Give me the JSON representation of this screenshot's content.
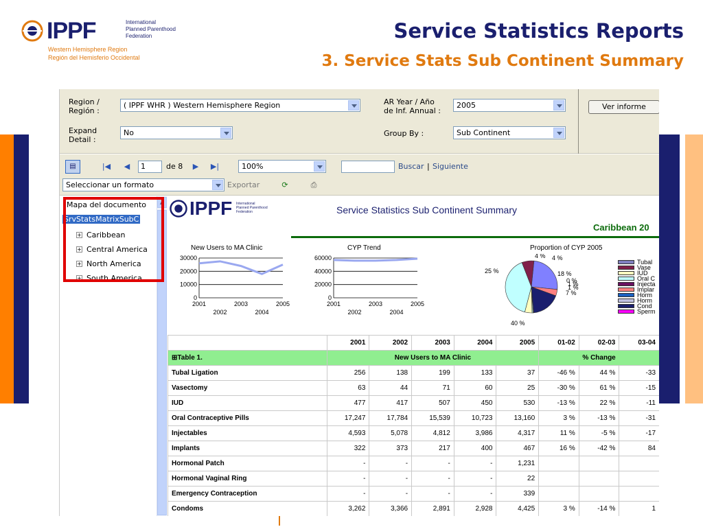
{
  "slide": {
    "logo_brand": "IPPF",
    "logo_federation": [
      "International",
      "Planned Parenthood",
      "Federation"
    ],
    "logo_region": [
      "Western Hemisphere Region",
      "Región del Hemisferio Occidental"
    ],
    "title": "Service Statistics Reports",
    "subtitle": "3. Service Stats Sub Continent Summary",
    "colors": {
      "navy": "#1a1f6e",
      "orange": "#ff7f00",
      "peach": "#ffc080",
      "accent_text": "#e07a10"
    }
  },
  "params": {
    "region_label": "Region /\nRegión :",
    "region_value": "( IPPF WHR ) Western Hemisphere Region",
    "year_label": "AR Year / Año\nde Inf. Annual :",
    "year_value": "2005",
    "expand_label": "Expand\nDetail :",
    "expand_value": "No",
    "groupby_label": "Group By :",
    "groupby_value": "Sub Continent",
    "view_button": "Ver informe"
  },
  "toolbar": {
    "page_current": "1",
    "page_of": "de 8",
    "zoom": "100%",
    "search_find": "Buscar",
    "search_sep": "|",
    "search_next": "Siguiente",
    "format_select": "Seleccionar un formato",
    "export_label": "Exportar",
    "icons": [
      "doc-map-toggle-icon",
      "first-page-icon",
      "prev-page-icon",
      "next-page-icon",
      "last-page-icon",
      "refresh-icon",
      "print-icon"
    ]
  },
  "docmap": {
    "title": "Mapa del documento",
    "root": "SrvStatsMatrixSubC",
    "items": [
      "Caribbean",
      "Central America",
      "North America",
      "South America"
    ]
  },
  "report": {
    "header_logo": "IPPF",
    "header_logo_small": [
      "International",
      "Planned Parenthood",
      "Federation"
    ],
    "title": "Service Statistics Sub Continent Summary",
    "subcontinent": "Caribbean 20",
    "chart_titles": [
      "New Users to MA Clinic",
      "CYP Trend",
      "Proportion of CYP 2005"
    ],
    "table": {
      "columns": [
        "2001",
        "2002",
        "2003",
        "2004",
        "2005",
        "01-02",
        "02-03",
        "03-04"
      ],
      "group_label": "Table 1.",
      "group_values": "New Users to MA Clinic",
      "group_change": "% Change",
      "rows": [
        {
          "name": "Tubal Ligation",
          "v": [
            "256",
            "138",
            "199",
            "133",
            "37"
          ],
          "p": [
            "-46 %",
            "44 %",
            "-33"
          ]
        },
        {
          "name": "Vasectomy",
          "v": [
            "63",
            "44",
            "71",
            "60",
            "25"
          ],
          "p": [
            "-30 %",
            "61 %",
            "-15"
          ]
        },
        {
          "name": "IUD",
          "v": [
            "477",
            "417",
            "507",
            "450",
            "530"
          ],
          "p": [
            "-13 %",
            "22 %",
            "-11"
          ]
        },
        {
          "name": "Oral Contraceptive Pills",
          "v": [
            "17,247",
            "17,784",
            "15,539",
            "10,723",
            "13,160"
          ],
          "p": [
            "3 %",
            "-13 %",
            "-31"
          ]
        },
        {
          "name": "Injectables",
          "v": [
            "4,593",
            "5,078",
            "4,812",
            "3,986",
            "4,317"
          ],
          "p": [
            "11 %",
            "-5 %",
            "-17"
          ]
        },
        {
          "name": "Implants",
          "v": [
            "322",
            "373",
            "217",
            "400",
            "467"
          ],
          "p": [
            "16 %",
            "-42 %",
            "84"
          ]
        },
        {
          "name": "Hormonal Patch",
          "v": [
            "-",
            "-",
            "-",
            "-",
            "1,231"
          ],
          "p": [
            "",
            "",
            ""
          ]
        },
        {
          "name": "Hormonal Vaginal Ring",
          "v": [
            "-",
            "-",
            "-",
            "-",
            "22"
          ],
          "p": [
            "",
            "",
            ""
          ]
        },
        {
          "name": "Emergency Contraception",
          "v": [
            "-",
            "-",
            "-",
            "-",
            "339"
          ],
          "p": [
            "",
            "",
            ""
          ]
        },
        {
          "name": "Condoms",
          "v": [
            "3,262",
            "3,366",
            "2,891",
            "2,928",
            "4,425"
          ],
          "p": [
            "3 %",
            "-14 %",
            "1"
          ]
        }
      ]
    }
  },
  "chart_data": [
    {
      "type": "line",
      "title": "New Users to MA Clinic",
      "x": [
        "2001",
        "2002",
        "2003",
        "2004",
        "2005"
      ],
      "series": [
        {
          "values": [
            26000,
            27500,
            24000,
            18000,
            25000
          ],
          "color": "#9aa8f0"
        }
      ],
      "yticks": [
        0,
        10000,
        20000,
        30000
      ],
      "xticks_top": [
        "2001",
        "2003",
        "2005"
      ],
      "xticks_bottom": [
        "2002",
        "2004"
      ],
      "ylim": [
        0,
        30000
      ]
    },
    {
      "type": "line",
      "title": "CYP Trend",
      "x": [
        "2001",
        "2002",
        "2003",
        "2004",
        "2005"
      ],
      "series": [
        {
          "values": [
            57000,
            56000,
            56000,
            57000,
            59000
          ],
          "color": "#9aa8f0"
        }
      ],
      "yticks": [
        0,
        20000,
        40000,
        60000
      ],
      "xticks_top": [
        "2001",
        "2003",
        "2005"
      ],
      "xticks_bottom": [
        "2002",
        "2004"
      ],
      "ylim": [
        0,
        60000
      ]
    },
    {
      "type": "pie",
      "title": "Proportion of CYP 2005",
      "slices": [
        {
          "label": "Tubal",
          "value": 25,
          "color": "#8080ff"
        },
        {
          "label": "Vase",
          "value": 4,
          "color": "#ff8080"
        },
        {
          "label": "IUD",
          "value": 18,
          "color": "#1a1f6e"
        },
        {
          "label": "Oral C",
          "value": 0.4,
          "color": "#ffffc0"
        },
        {
          "label": "Injecta",
          "value": 0.6,
          "color": "#c0ffff"
        },
        {
          "label": "Implar",
          "value": 4.5,
          "color": "#ffffc0"
        },
        {
          "label": "Horm",
          "value": 40,
          "color": "#c0ffff"
        },
        {
          "label": "Sperm",
          "value": 7.5,
          "color": "#80204a"
        }
      ],
      "data_labels": [
        "4 %",
        "4 %",
        "18 %",
        "0 %",
        "1 %",
        "1 %",
        "7 %",
        "40 %",
        "25 %"
      ],
      "legend": [
        "Tubal",
        "Vase",
        "IUD",
        "Oral C",
        "Injecta",
        "Implar",
        "Horm",
        "Horm",
        "Cond",
        "Sperm"
      ],
      "legend_colors": [
        "#8080c0",
        "#80204a",
        "#ffffc0",
        "#c0ffff",
        "#6a1060",
        "#ff8080",
        "#1a60c0",
        "#c0c0e0",
        "#1a1f6e",
        "#ff00ff"
      ]
    }
  ]
}
